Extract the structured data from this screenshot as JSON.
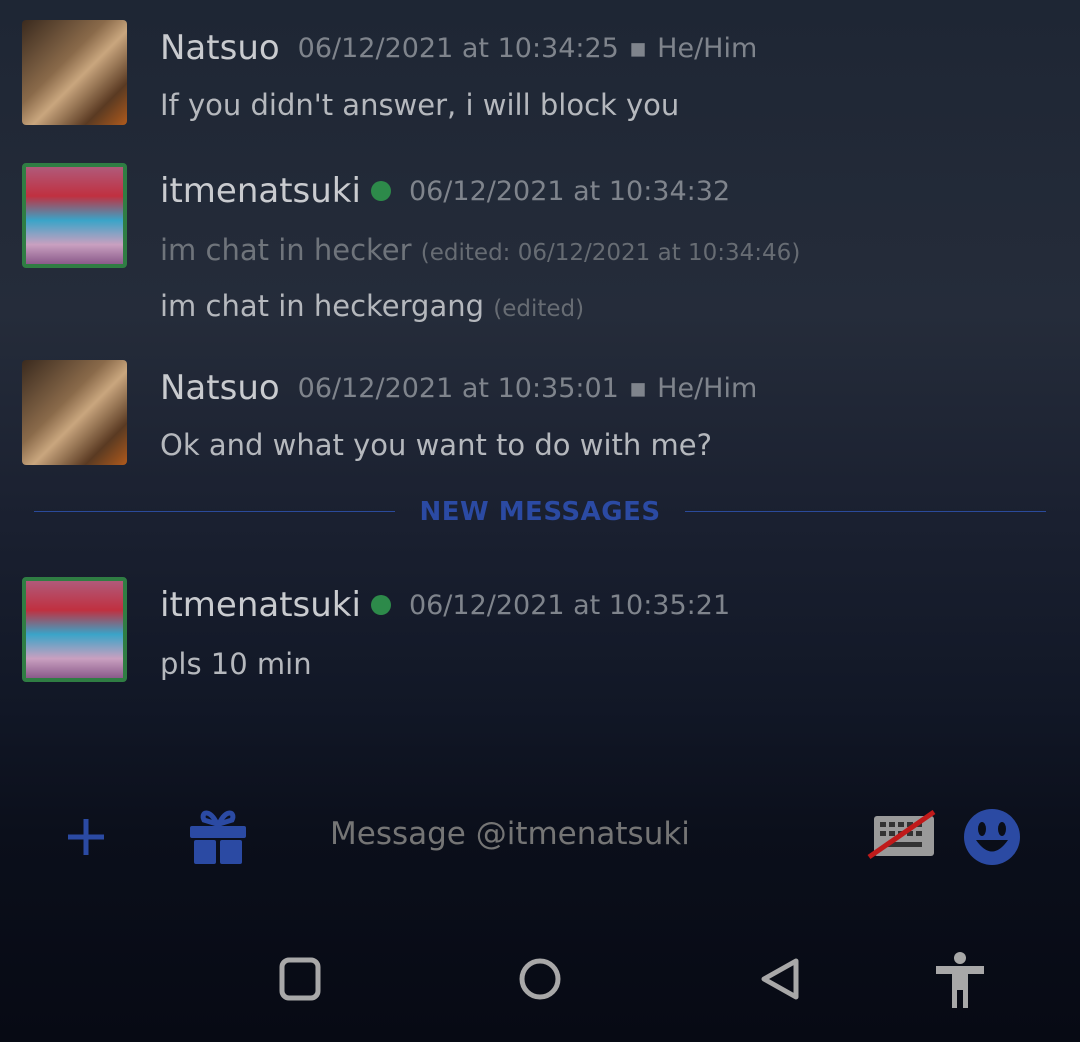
{
  "messages": [
    {
      "author": "Natsuo",
      "timestamp": "06/12/2021 at 10:34:25",
      "pronouns": "He/Him",
      "lines": [
        {
          "text": "If you didn't answer, i will block you"
        }
      ]
    },
    {
      "author": "itmenatsuki",
      "online": true,
      "timestamp": "06/12/2021 at 10:34:32",
      "lines": [
        {
          "text": "im chat in hecker",
          "edited": "(edited: 06/12/2021 at 10:34:46)"
        },
        {
          "text": "im chat in heckergang",
          "edited": "(edited)"
        }
      ]
    },
    {
      "author": "Natsuo",
      "timestamp": "06/12/2021 at 10:35:01",
      "pronouns": "He/Him",
      "lines": [
        {
          "text": "Ok and what you want to do with me?"
        }
      ]
    },
    {
      "author": "itmenatsuki",
      "online": true,
      "timestamp": "06/12/2021 at 10:35:21",
      "lines": [
        {
          "text": "pls 10 min"
        }
      ]
    }
  ],
  "divider": {
    "label": "NEW MESSAGES"
  },
  "composer": {
    "placeholder": "Message @itmenatsuki",
    "icons": [
      "plus-icon",
      "gift-icon",
      "keyboard-off-icon",
      "emoji-icon"
    ]
  },
  "navbar": {
    "icons": [
      "recents-icon",
      "home-icon",
      "back-icon",
      "accessibility-icon"
    ]
  },
  "colors": {
    "accent": "#2b4aa3",
    "online": "#2d8a4a",
    "disabled_slash": "#c01a1a"
  }
}
